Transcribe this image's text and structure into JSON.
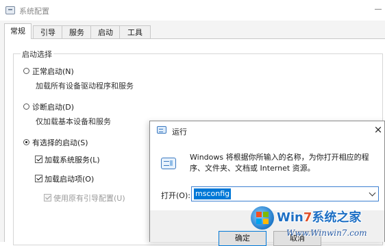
{
  "system_config": {
    "title": "系统配置",
    "tabs": [
      {
        "label": "常规",
        "active": true
      },
      {
        "label": "引导",
        "active": false
      },
      {
        "label": "服务",
        "active": false
      },
      {
        "label": "启动",
        "active": false
      },
      {
        "label": "工具",
        "active": false
      }
    ],
    "startup_group": {
      "title": "启动选择",
      "normal": {
        "label": "正常启动(N)",
        "description": "加载所有设备驱动程序和服务",
        "selected": false
      },
      "diagnostic": {
        "label": "诊断启动(D)",
        "description": "仅加载基本设备和服务",
        "selected": false
      },
      "selective": {
        "label": "有选择的启动(S)",
        "selected": true
      },
      "load_services": {
        "label": "加载系统服务(L)",
        "checked": true
      },
      "load_startup": {
        "label": "加载启动项(O)",
        "checked": true
      },
      "use_original_boot": {
        "label": "使用原有引导配置(U)",
        "checked": true,
        "disabled": true
      }
    }
  },
  "run_dialog": {
    "title": "运行",
    "close_glyph": "×",
    "description": "Windows 将根据你所输入的名称，为你打开相应的程序、文件夹、文档或 Internet 资源。",
    "open_label": "打开(O):",
    "input_value": "msconfig",
    "ok_label": "确定",
    "cancel_label": "取消"
  },
  "watermark": {
    "brand_prefix": "Win",
    "brand_seven": "7",
    "brand_suffix": "系统之家",
    "url": "Www.Winwin7.com"
  },
  "colors": {
    "accent": "#0078d7",
    "watermark_blue": "#1d6fc4",
    "watermark_orange": "#e0502a"
  }
}
